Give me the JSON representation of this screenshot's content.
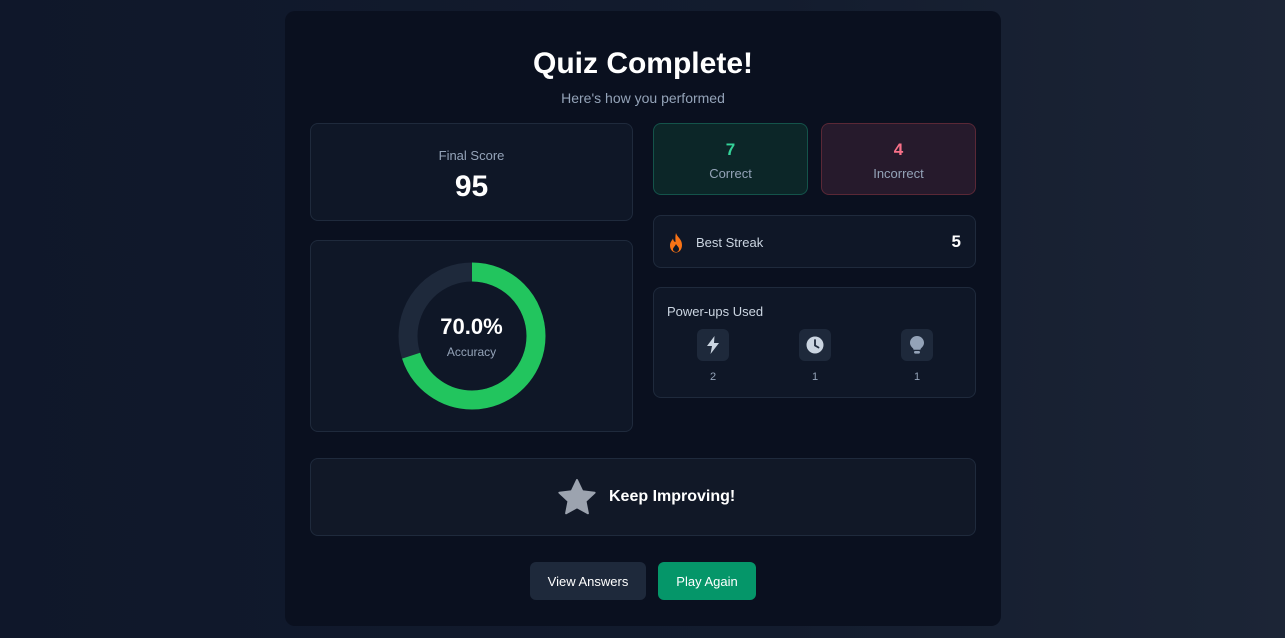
{
  "header": {
    "title": "Quiz Complete!",
    "subtitle": "Here's how you performed"
  },
  "score": {
    "label": "Final Score",
    "value": "95"
  },
  "accuracy": {
    "value_text": "70.0%",
    "label": "Accuracy",
    "fraction": 0.7,
    "color": "#22c55e",
    "track_color": "#1e293b"
  },
  "results": {
    "correct": {
      "value": "7",
      "label": "Correct",
      "color": "#34d399"
    },
    "incorrect": {
      "value": "4",
      "label": "Incorrect",
      "color": "#f87189"
    }
  },
  "streak": {
    "icon": "flame-icon",
    "label": "Best Streak",
    "value": "5",
    "icon_color": "#f97316"
  },
  "powerups": {
    "title": "Power-ups Used",
    "items": [
      {
        "icon": "lightning-icon",
        "count": "2"
      },
      {
        "icon": "clock-icon",
        "count": "1"
      },
      {
        "icon": "lightbulb-icon",
        "count": "1"
      }
    ]
  },
  "banner": {
    "icon": "star-icon",
    "text": "Keep Improving!"
  },
  "actions": {
    "view_answers": "View Answers",
    "play_again": "Play Again"
  }
}
